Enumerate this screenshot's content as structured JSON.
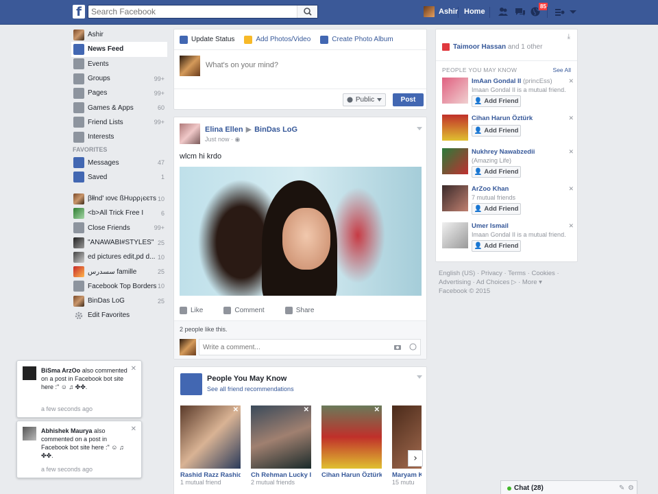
{
  "topbar": {
    "logo": "f",
    "search_placeholder": "Search Facebook",
    "user_name": "Ashir",
    "home_label": "Home",
    "notification_count": "85"
  },
  "leftnav": {
    "profile": "Ashir",
    "items": [
      {
        "label": "News Feed",
        "count": "",
        "icon": "news-feed-icon"
      },
      {
        "label": "Events",
        "count": "",
        "icon": "calendar-icon"
      },
      {
        "label": "Groups",
        "count": "99+",
        "icon": "groups-icon"
      },
      {
        "label": "Pages",
        "count": "99+",
        "icon": "pages-flag-icon"
      },
      {
        "label": "Games & Apps",
        "count": "60",
        "icon": "games-icon"
      },
      {
        "label": "Friend Lists",
        "count": "99+",
        "icon": "friend-lists-icon"
      },
      {
        "label": "Interests",
        "count": "",
        "icon": "interests-icon"
      }
    ],
    "favorites_header": "FAVORITES",
    "favorites": [
      {
        "label": "Messages",
        "count": "47",
        "icon": "messages-icon"
      },
      {
        "label": "Saved",
        "count": "1",
        "icon": "saved-bookmark-icon"
      }
    ],
    "groups": [
      {
        "label": "βłłnd' ιονє ßHυρρ¡єєтѕ",
        "count": "10"
      },
      {
        "label": "<b>All Trick Free I",
        "count": "6"
      },
      {
        "label": "Close Friends",
        "count": "99+"
      },
      {
        "label": "\"ANAWABI#STYLES\"",
        "count": "25"
      },
      {
        "label": "ed pictures edit,pd d...",
        "count": "10"
      },
      {
        "label": "سسدرس famille",
        "count": "25"
      },
      {
        "label": "Facebook Top Borders",
        "count": "10"
      },
      {
        "label": "BinDas LoG",
        "count": "25"
      }
    ],
    "edit_favorites": "Edit Favorites"
  },
  "composer": {
    "tabs": [
      "Update Status",
      "Add Photos/Video",
      "Create Photo Album"
    ],
    "placeholder": "What's on your mind?",
    "privacy": "Public",
    "post_button": "Post"
  },
  "post": {
    "author": "Elina Ellen",
    "target": "BinDas LoG",
    "time": "Just now",
    "text": "wlcm hi krdo",
    "actions": [
      "Like",
      "Comment",
      "Share"
    ],
    "likes_text": "2 people like this.",
    "comment_placeholder": "Write a comment..."
  },
  "pymk_feed": {
    "title": "People You May Know",
    "subtitle": "See all friend recommendations",
    "cards": [
      {
        "name": "Rashid Razz Rashid",
        "mutual": "1 mutual friend"
      },
      {
        "name": "Ch Rehman Lucky II",
        "mutual": "2 mutual friends"
      },
      {
        "name": "Cihan Harun Öztürk",
        "mutual": ""
      },
      {
        "name": "Maryam K",
        "mutual": "15 mutu"
      }
    ]
  },
  "right": {
    "header_name": "Taimoor Hassan",
    "header_rest": " and 1 other",
    "section_title": "PEOPLE YOU MAY KNOW",
    "see_all": "See All",
    "add_friend": "Add Friend",
    "suggestions": [
      {
        "name": "ImAan Gondal II",
        "extra": " (princEss)",
        "mutual": "Imaan Gondal II is a mutual friend."
      },
      {
        "name": "Cihan Harun Öztürk",
        "extra": "",
        "mutual": ""
      },
      {
        "name": "Nukhrey Nawabzedii",
        "extra": "",
        "mutual": "(Amazing Life)"
      },
      {
        "name": "ArZoo Khan",
        "extra": "",
        "mutual": "7 mutual friends"
      },
      {
        "name": "Umer Ismail",
        "extra": "",
        "mutual": "Imaan Gondal II is a mutual friend."
      }
    ],
    "footer": "English (US) · Privacy · Terms · Cookies · Advertising · Ad Choices ▷ · More ▾",
    "copyright": "Facebook © 2015"
  },
  "notifications": [
    {
      "name": "BiSma ArzOo",
      "text": " also commented on a post in Facebook bot site here :\" ☺ ♫ ✤✤.",
      "time": "a few seconds ago"
    },
    {
      "name": "Abhishek Maurya",
      "text": " also commented on a post in Facebook bot site here :\" ☺ ♫ ✤✤.",
      "time": "a few seconds ago"
    }
  ],
  "chat": {
    "label": "Chat (28)"
  },
  "colors": {
    "brand": "#3b5998",
    "link": "#365899",
    "button": "#4267b2",
    "online": "#42b72a",
    "badge": "#fa3e3e"
  }
}
